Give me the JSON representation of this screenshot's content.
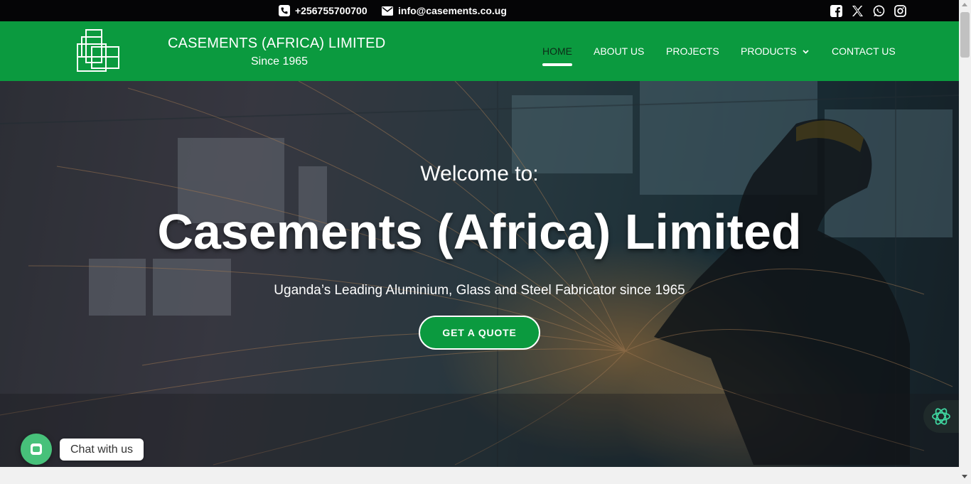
{
  "topbar": {
    "phone": "+256755700700",
    "email": "info@casements.co.ug",
    "socials": [
      "facebook-icon",
      "x-icon",
      "whatsapp-icon",
      "instagram-icon"
    ]
  },
  "brand": {
    "title": "CASEMENTS (AFRICA) LIMITED",
    "subtitle": "Since 1965"
  },
  "nav": {
    "items": [
      {
        "label": "HOME",
        "active": true
      },
      {
        "label": "ABOUT US"
      },
      {
        "label": "PROJECTS"
      },
      {
        "label": "PRODUCTS"
      },
      {
        "label": "CONTACT US"
      }
    ]
  },
  "hero": {
    "welcome": "Welcome to:",
    "headline": "Casements (Africa) Limited",
    "tagline": "Uganda’s Leading Aluminium, Glass and Steel Fabricator since 1965",
    "cta": "GET A QUOTE"
  },
  "chat": {
    "label": "Chat with us"
  },
  "colors": {
    "brand_green": "#0b9a3f",
    "topbar_bg": "#050506",
    "chat_green": "#47c17a"
  }
}
